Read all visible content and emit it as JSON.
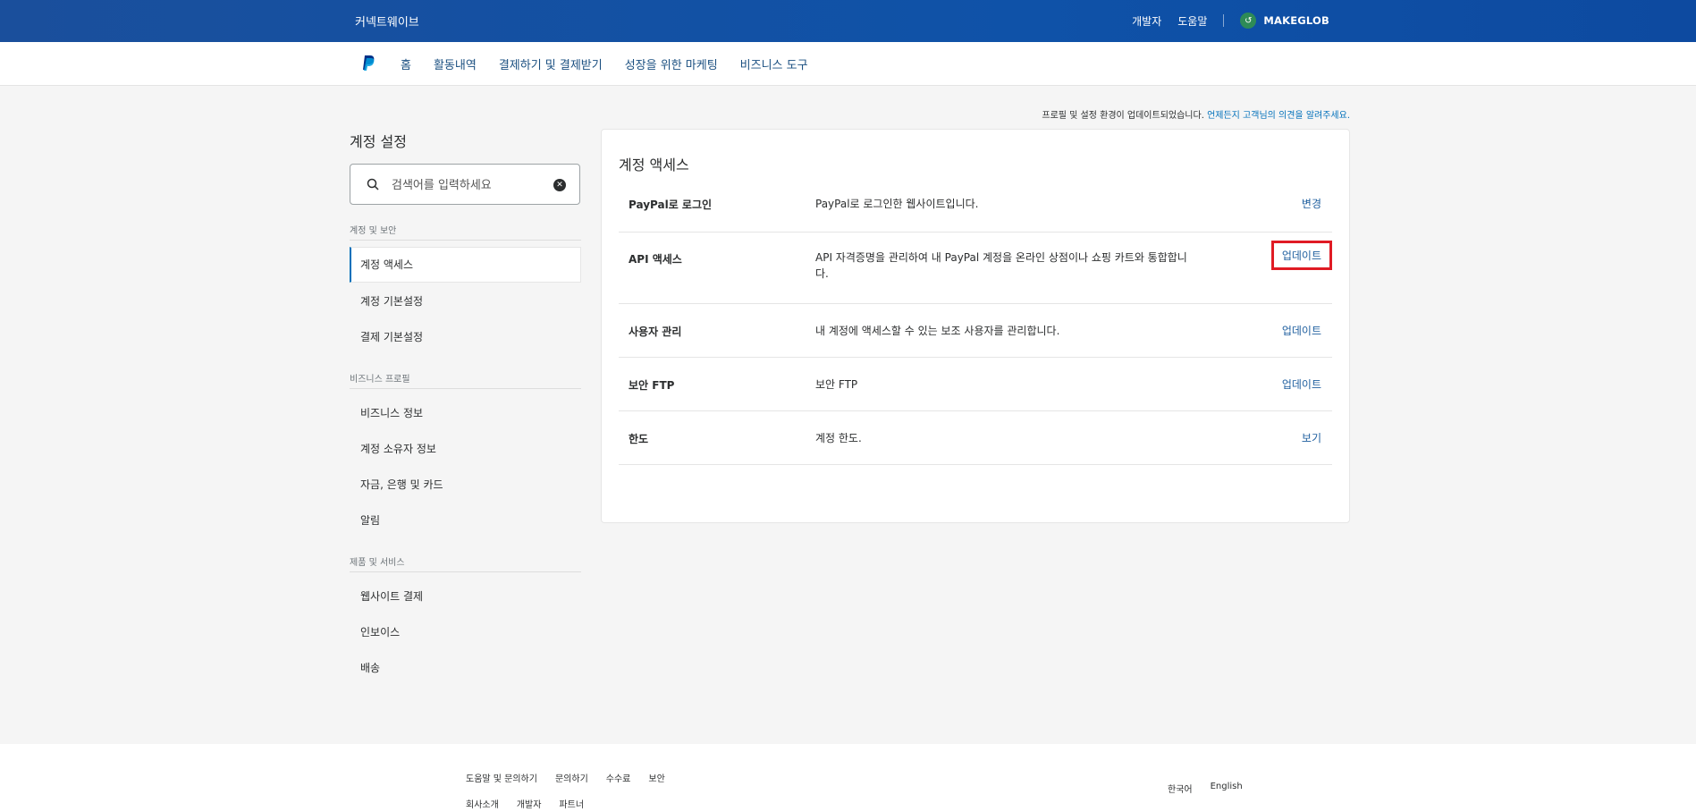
{
  "topbar": {
    "brand": "커넥트웨이브",
    "links": [
      "개발자",
      "도움말"
    ],
    "user_avatar_glyph": "↺",
    "user_name": "MAKEGLOB"
  },
  "nav": {
    "logo_icon": "paypal-logo",
    "items": [
      "홈",
      "활동내역",
      "결제하기 및 결제받기",
      "성장을 위한 마케팅",
      "비즈니스 도구"
    ]
  },
  "notice": {
    "text": "프로필 및 설정 환경이 업데이트되었습니다.",
    "link": "언제든지 고객님의 의견을 알려주세요."
  },
  "sidebar": {
    "title": "계정 설정",
    "search": {
      "placeholder": "검색어를 입력하세요"
    },
    "sections": [
      {
        "label": "계정 및 보안",
        "items": [
          "계정 액세스",
          "계정 기본설정",
          "결제 기본설정"
        ]
      },
      {
        "label": "비즈니스 프로필",
        "items": [
          "비즈니스 정보",
          "계정 소유자 정보",
          "자금, 은행 및 카드",
          "알림"
        ]
      },
      {
        "label": "제품 및 서비스",
        "items": [
          "웹사이트 결제",
          "인보이스",
          "배송"
        ]
      }
    ]
  },
  "main": {
    "title": "계정 액세스",
    "rows": [
      {
        "label": "PayPal로 로그인",
        "desc": "PayPal로 로그인한 웹사이트입니다.",
        "action": "변경"
      },
      {
        "label": "API 액세스",
        "desc": "API 자격증명을 관리하여 내 PayPal 계정을 온라인 상점이나 쇼핑 카트와 통합합니다.",
        "action": "업데이트"
      },
      {
        "label": "사용자 관리",
        "desc": "내 계정에 액세스할 수 있는 보조 사용자를 관리합니다.",
        "action": "업데이트"
      },
      {
        "label": "보안 FTP",
        "desc": "보안 FTP",
        "action": "업데이트"
      },
      {
        "label": "한도",
        "desc": "계정 한도.",
        "action": "보기"
      }
    ]
  },
  "footer": {
    "links_row1": [
      "도움말 및 문의하기",
      "문의하기",
      "수수료",
      "보안"
    ],
    "links_row2": [
      "회사소개",
      "개발자",
      "파트너"
    ],
    "languages": [
      "한국어",
      "English"
    ]
  },
  "colors": {
    "topbar": "#0f52a8",
    "link": "#0070ba",
    "highlight": "#e01b24"
  }
}
